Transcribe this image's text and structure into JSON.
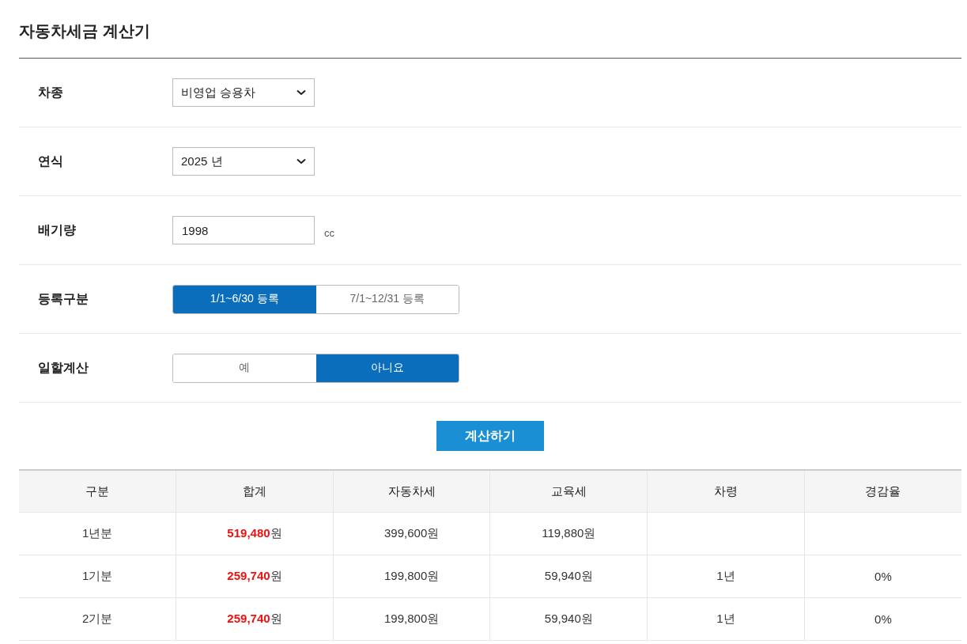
{
  "title": "자동차세금 계산기",
  "form": [
    {
      "kind": "select",
      "label": "차종",
      "value": "비영업 승용차"
    },
    {
      "kind": "select",
      "label": "연식",
      "value": "2025 년"
    },
    {
      "kind": "input",
      "label": "배기량",
      "value": "1998",
      "unit": "cc"
    },
    {
      "kind": "toggle",
      "label": "등록구분",
      "options": [
        {
          "label": "1/1~6/30 등록",
          "selected": true
        },
        {
          "label": "7/1~12/31 등록",
          "selected": false
        }
      ]
    },
    {
      "kind": "toggle",
      "label": "일할계산",
      "options": [
        {
          "label": "예",
          "selected": false
        },
        {
          "label": "아니요",
          "selected": true
        }
      ]
    }
  ],
  "calculate_button": "계산하기",
  "table": {
    "columns": [
      "구분",
      "합계",
      "자동차세",
      "교육세",
      "차령",
      "경감율"
    ],
    "rows": [
      [
        "1년분",
        "**519,480**원",
        "399,600원",
        "119,880원",
        null,
        null
      ],
      [
        "1기분",
        "**259,740**원",
        "199,800원",
        "59,940원",
        "1년",
        "0%"
      ],
      [
        "2기분",
        "**259,740**원",
        "199,800원",
        "59,940원",
        "1년",
        "0%"
      ]
    ]
  }
}
